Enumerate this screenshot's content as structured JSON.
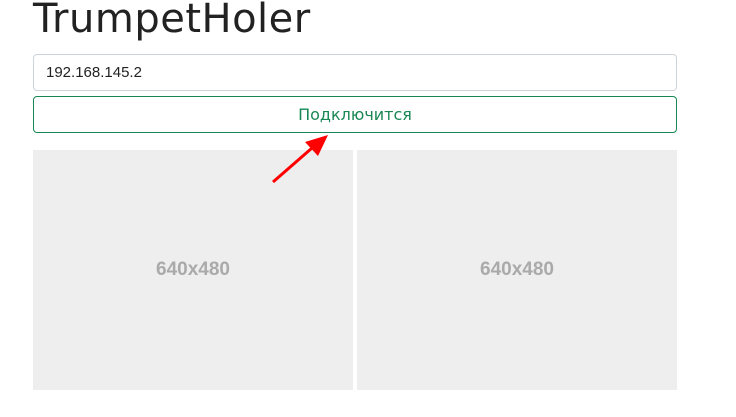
{
  "title": "TrumpetHoler",
  "ip_input": {
    "value": "192.168.145.2"
  },
  "connect_button": "Подключится",
  "streams": [
    {
      "label": "640x480"
    },
    {
      "label": "640x480"
    }
  ],
  "annotation": {
    "color": "#ff0000",
    "icon": "red-arrow-icon"
  }
}
